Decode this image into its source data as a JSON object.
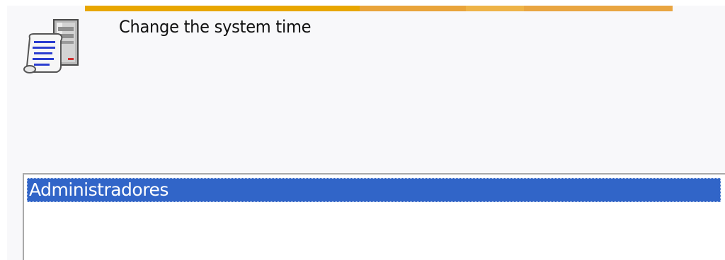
{
  "window": {
    "accent_colors": [
      "#e8a600",
      "#e9a43a",
      "#eeb347",
      "#e9a541"
    ]
  },
  "policy": {
    "icon": "policy-server-scroll-icon",
    "title": "Change the system time"
  },
  "members": {
    "items": [
      {
        "label": "Administradores",
        "selected": true
      }
    ],
    "selection_color": "#3165c8"
  }
}
